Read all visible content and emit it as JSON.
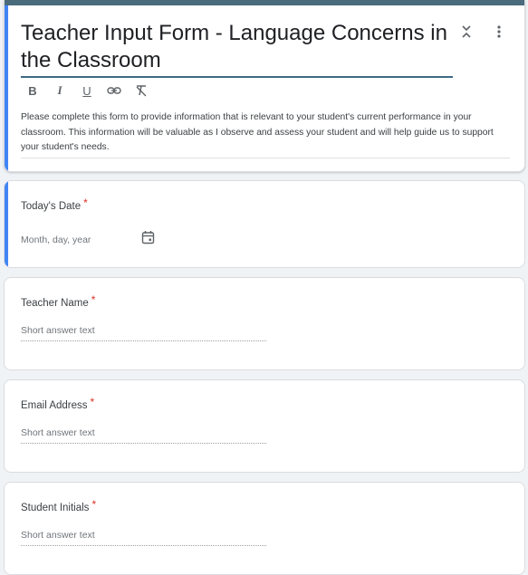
{
  "form": {
    "title": "Teacher Input Form - Language Concerns in the Classroom",
    "description": "Please complete this form to provide information that is relevant to your student's current performance in your classroom. This information will be valuable as I observe and assess your student and will help guide us to support your student's needs.",
    "toolbar": [
      "B",
      "I",
      "U",
      "link",
      "clear-formatting"
    ]
  },
  "questions": [
    {
      "label": "Today's Date",
      "required_mark": "*",
      "placeholder": "Month, day, year"
    },
    {
      "label": "Teacher Name",
      "required_mark": "*",
      "placeholder": "Short answer text"
    },
    {
      "label": "Email Address",
      "required_mark": "*",
      "placeholder": "Short answer text"
    },
    {
      "label": "Student Initials",
      "required_mark": "*",
      "placeholder": "Short answer text"
    }
  ],
  "colors": {
    "accent": "#4285f4",
    "title_strip": "#4a6b7c",
    "required": "#d93025"
  }
}
